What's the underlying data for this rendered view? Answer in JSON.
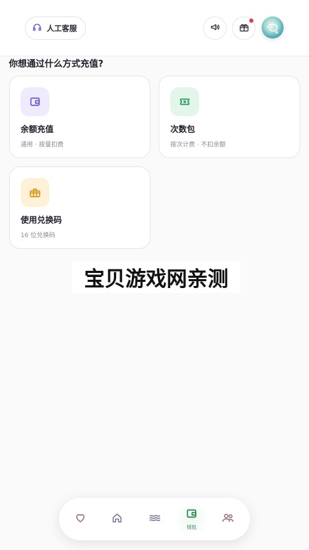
{
  "header": {
    "support_label": "人工客服",
    "notice_icon": "megaphone-icon",
    "gift_icon": "gift-icon",
    "gift_has_badge": true
  },
  "main": {
    "section_title": "你想通过什么方式充值?",
    "options": [
      {
        "title": "余额充值",
        "desc": "通用 · 按量扣费",
        "icon": "wallet-icon",
        "color": "#6b5bd6"
      },
      {
        "title": "次数包",
        "desc": "按次计费 · 不扣余额",
        "icon": "ticket-icon",
        "color": "#2e9e62"
      },
      {
        "title": "使用兑换码",
        "desc": "16 位兑换码",
        "icon": "gift-box-icon",
        "color": "#d89a1e"
      }
    ]
  },
  "watermark": "宝贝游戏网亲测",
  "bottom_nav": {
    "items": [
      {
        "icon": "heart-icon"
      },
      {
        "icon": "home-icon"
      },
      {
        "icon": "waves-icon"
      },
      {
        "icon": "wallet-icon",
        "label": "钱包",
        "active": true
      },
      {
        "icon": "users-icon"
      }
    ]
  }
}
